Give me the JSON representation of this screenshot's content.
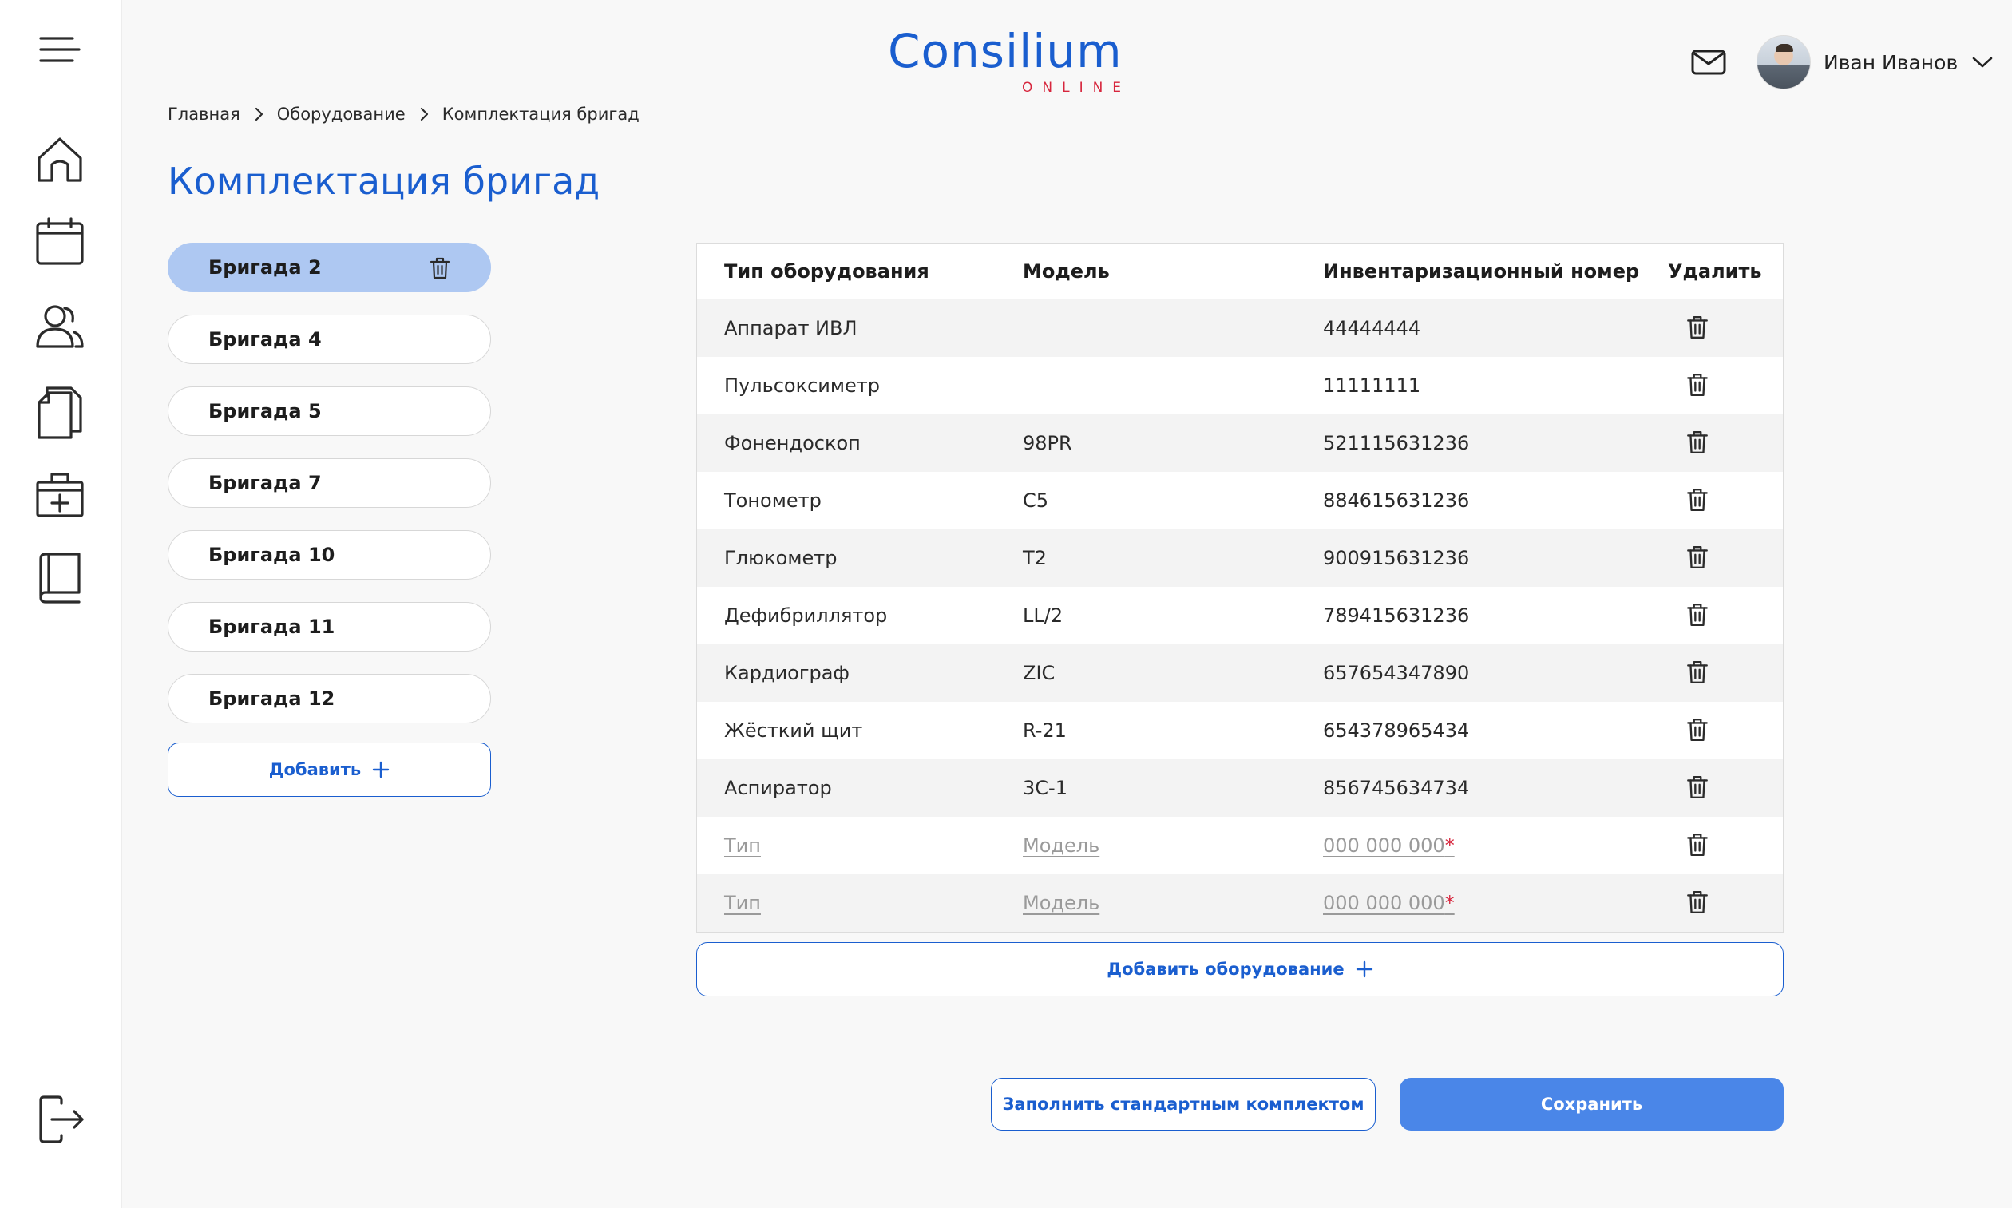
{
  "header": {
    "logo_main": "Consilium",
    "logo_sub": "ONLINE",
    "user_name": "Иван Иванов"
  },
  "sidebar": {
    "items": [
      {
        "icon": "menu-icon"
      },
      {
        "icon": "home-icon"
      },
      {
        "icon": "calendar-icon"
      },
      {
        "icon": "users-icon"
      },
      {
        "icon": "documents-icon"
      },
      {
        "icon": "medkit-icon"
      },
      {
        "icon": "book-icon"
      },
      {
        "icon": "logout-icon"
      }
    ]
  },
  "breadcrumb": [
    "Главная",
    "Оборудование",
    "Комплектация бригад"
  ],
  "page_title": "Комплектация бригад",
  "brigades": {
    "items": [
      "Бригада 2",
      "Бригада 4",
      "Бригада 5",
      "Бригада 7",
      "Бригада 10",
      "Бригада 11",
      "Бригада 12"
    ],
    "active_index": 0,
    "add_label": "Добавить"
  },
  "table": {
    "columns": [
      "Тип оборудования",
      "Модель",
      "Инвентаризационный номер",
      "Удалить"
    ],
    "rows": [
      {
        "type": "Аппарат ИВЛ",
        "model": "",
        "inventory": "44444444"
      },
      {
        "type": "Пульсоксиметр",
        "model": "",
        "inventory": "11111111"
      },
      {
        "type": "Фонендоскоп",
        "model": "98PR",
        "inventory": "521115631236"
      },
      {
        "type": "Тонометр",
        "model": "C5",
        "inventory": "884615631236"
      },
      {
        "type": "Глюкометр",
        "model": "T2",
        "inventory": "900915631236"
      },
      {
        "type": "Дефибриллятор",
        "model": "LL/2",
        "inventory": "789415631236"
      },
      {
        "type": "Кардиограф",
        "model": "ZIC",
        "inventory": "657654347890"
      },
      {
        "type": "Жёсткий щит",
        "model": "R-21",
        "inventory": "654378965434"
      },
      {
        "type": "Аспиратор",
        "model": "3C-1",
        "inventory": "856745634734"
      }
    ],
    "new_rows": [
      {
        "type_placeholder": "Тип",
        "model_placeholder": "Модель",
        "inventory_placeholder": "000 000 000",
        "required_mark": "*"
      },
      {
        "type_placeholder": "Тип",
        "model_placeholder": "Модель",
        "inventory_placeholder": "000 000 000",
        "required_mark": "*"
      }
    ]
  },
  "actions": {
    "add_equipment": "Добавить оборудование",
    "fill_standard": "Заполнить стандартным комплектом",
    "save": "Сохранить"
  },
  "colors": {
    "accent": "#1a5ecf",
    "logo_sub": "#d7263d",
    "active_brigade": "#aec8f2",
    "save_button": "#4a86e8"
  }
}
